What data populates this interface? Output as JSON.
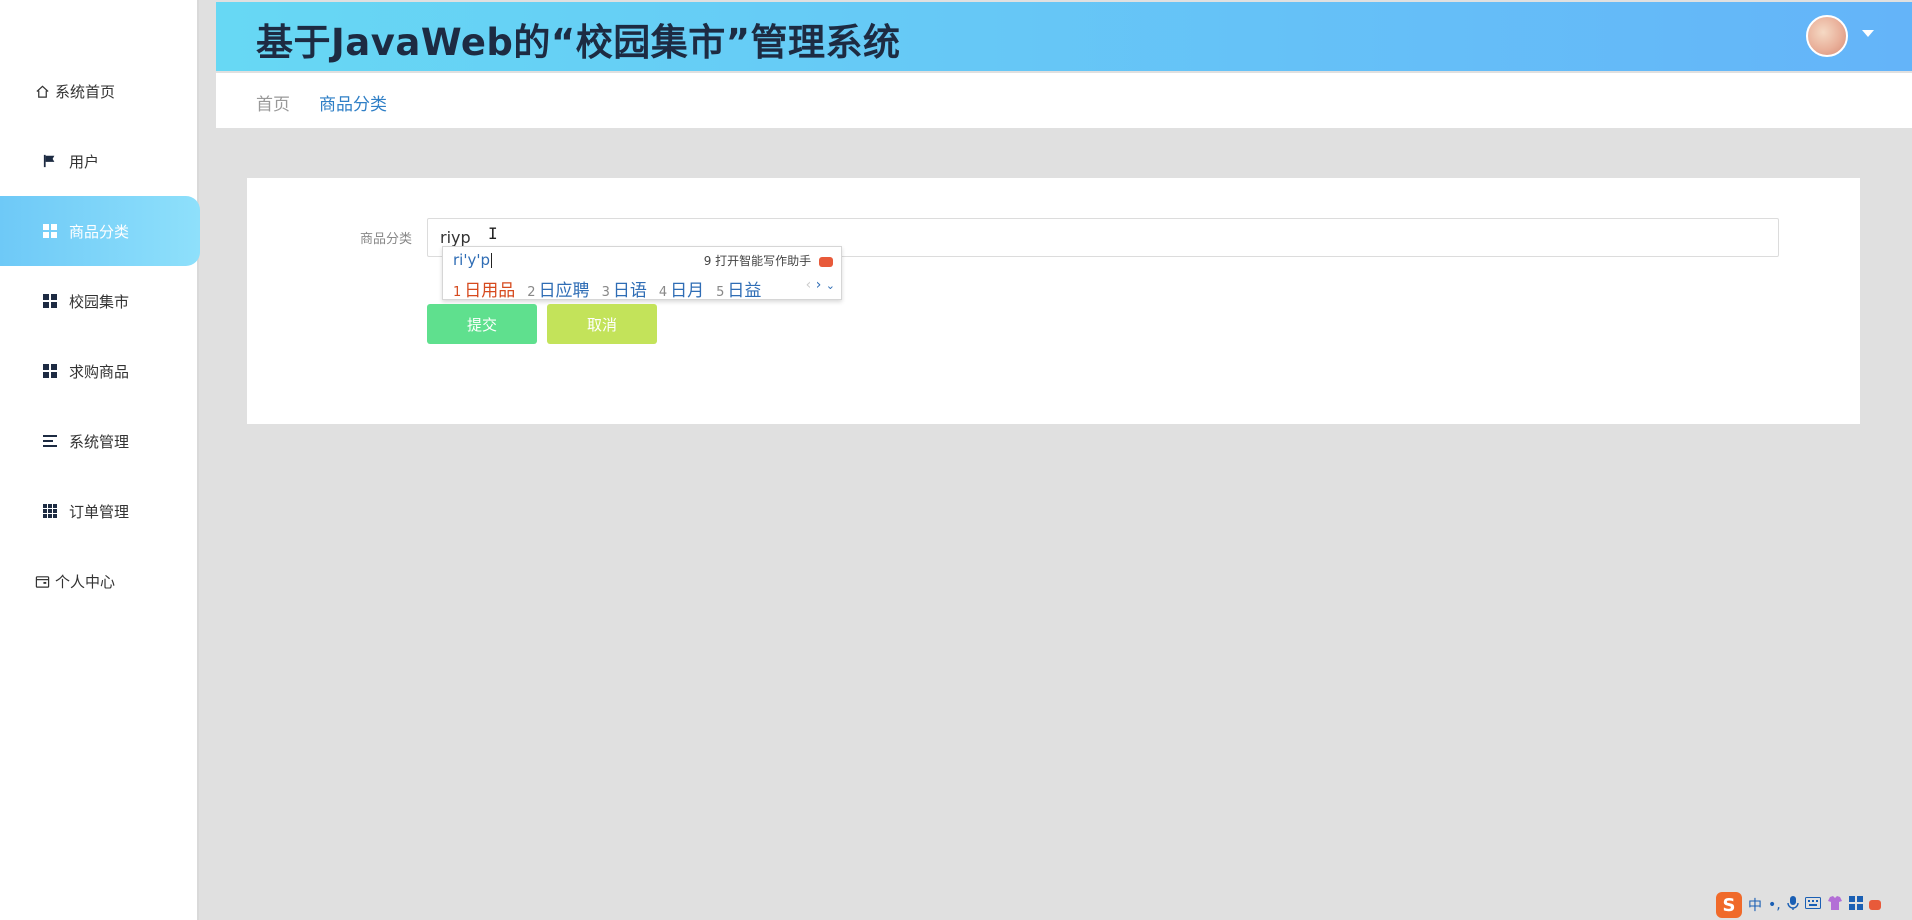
{
  "header": {
    "title": "基于JavaWeb的“校园集市”管理系统"
  },
  "sidebar": {
    "items": [
      {
        "label": "系统首页",
        "icon": "home-icon"
      },
      {
        "label": "用户",
        "icon": "flag-icon"
      },
      {
        "label": "商品分类",
        "icon": "grid-icon",
        "active": true
      },
      {
        "label": "校园集市",
        "icon": "grid-icon"
      },
      {
        "label": "求购商品",
        "icon": "grid-icon"
      },
      {
        "label": "系统管理",
        "icon": "menu-lines-icon"
      },
      {
        "label": "订单管理",
        "icon": "grid-9-icon"
      },
      {
        "label": "个人中心",
        "icon": "wallet-icon"
      }
    ]
  },
  "breadcrumb": {
    "home": "首页",
    "current": "商品分类"
  },
  "form": {
    "category_label": "商品分类",
    "category_value": "riyp",
    "submit_label": "提交",
    "cancel_label": "取消"
  },
  "ime": {
    "composition": "ri'y'p",
    "assist": "9 打开智能写作助手",
    "candidates": [
      {
        "num": "1",
        "text": "日用品"
      },
      {
        "num": "2",
        "text": "日应聘"
      },
      {
        "num": "3",
        "text": "日语"
      },
      {
        "num": "4",
        "text": "日月"
      },
      {
        "num": "5",
        "text": "日益"
      }
    ]
  },
  "tray": {
    "lang": "中",
    "punct": "•,"
  },
  "colors": {
    "header_gradient_start": "#67d8f4",
    "header_gradient_end": "#64b4f9",
    "active_nav": "#6ec9f7",
    "submit": "#5fe08e",
    "cancel": "#c3e35a"
  }
}
